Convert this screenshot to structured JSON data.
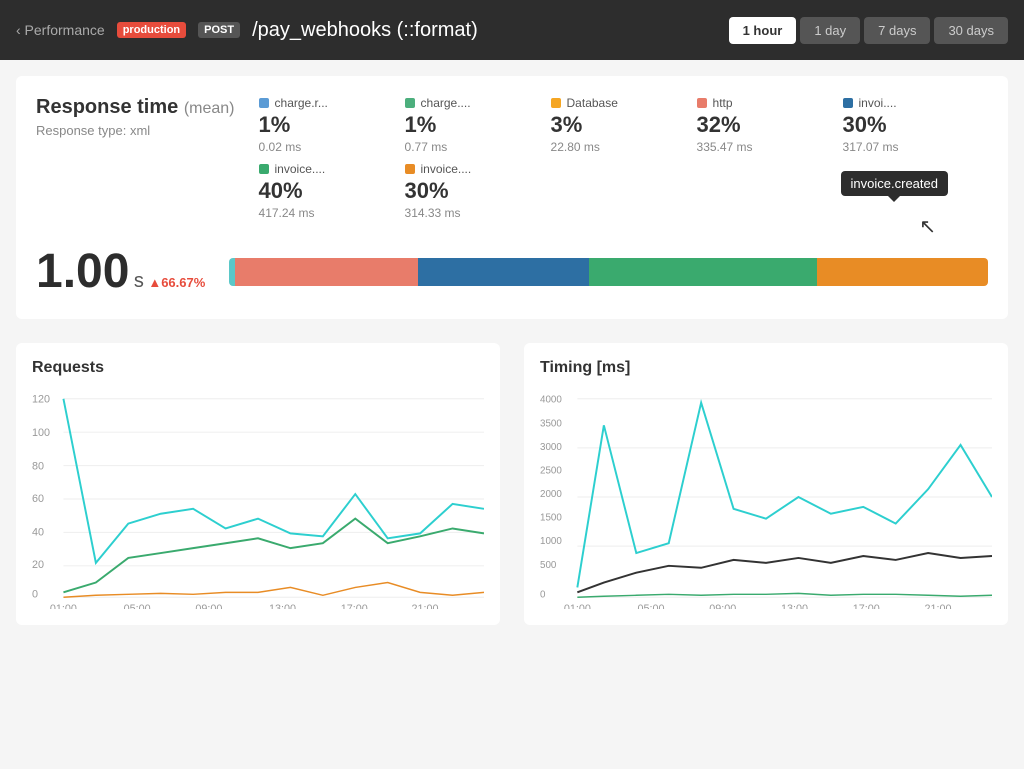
{
  "topbar": {
    "back_label": "‹ Performance",
    "badge_env": "production",
    "badge_method": "POST",
    "route": "/pay_webhooks (::format)",
    "time_buttons": [
      "1 hour",
      "1 day",
      "7 days",
      "30 days"
    ],
    "active_time": "1 hour"
  },
  "response_card": {
    "title": "Response time",
    "title_suffix": "(mean)",
    "response_type": "Response type: xml",
    "big_value": "1.00",
    "big_unit": "s",
    "change": "▲66.67%",
    "tooltip": "invoice.created",
    "legend": [
      {
        "label": "charge.r...",
        "color": "#5b9bd5",
        "pct": "1%",
        "ms": "0.02 ms"
      },
      {
        "label": "charge....",
        "color": "#4caf7d",
        "pct": "1%",
        "ms": "0.77 ms"
      },
      {
        "label": "Database",
        "color": "#f5a623",
        "pct": "3%",
        "ms": "22.80 ms"
      },
      {
        "label": "http",
        "color": "#e87c6a",
        "pct": "32%",
        "ms": "335.47 ms"
      },
      {
        "label": "invoi....",
        "color": "#2d6fa3",
        "pct": "30%",
        "ms": "317.07 ms"
      },
      {
        "label": "invoice....",
        "color": "#3aaa6e",
        "pct": "40%",
        "ms": "417.24 ms"
      },
      {
        "label": "invoice....",
        "color": "#e88c25",
        "pct": "30%",
        "ms": "314.33 ms"
      }
    ],
    "bar_segments": [
      {
        "color": "#5bc8c8",
        "flex": 1
      },
      {
        "color": "#e87c6a",
        "flex": 32
      },
      {
        "color": "#2d6fa3",
        "flex": 30
      },
      {
        "color": "#3aaa6e",
        "flex": 40
      },
      {
        "color": "#e88c25",
        "flex": 30
      }
    ]
  },
  "requests_chart": {
    "title": "Requests",
    "y_labels": [
      "120",
      "100",
      "80",
      "60",
      "40",
      "20",
      "0"
    ],
    "x_labels": [
      "01:00",
      "05:00",
      "09:00",
      "13:00",
      "17:00",
      "21:00"
    ]
  },
  "timing_chart": {
    "title": "Timing [ms]",
    "y_labels": [
      "4000",
      "3500",
      "3000",
      "2500",
      "2000",
      "1500",
      "1000",
      "500",
      "0"
    ],
    "x_labels": [
      "01:00",
      "05:00",
      "09:00",
      "13:00",
      "17:00",
      "21:00"
    ]
  }
}
